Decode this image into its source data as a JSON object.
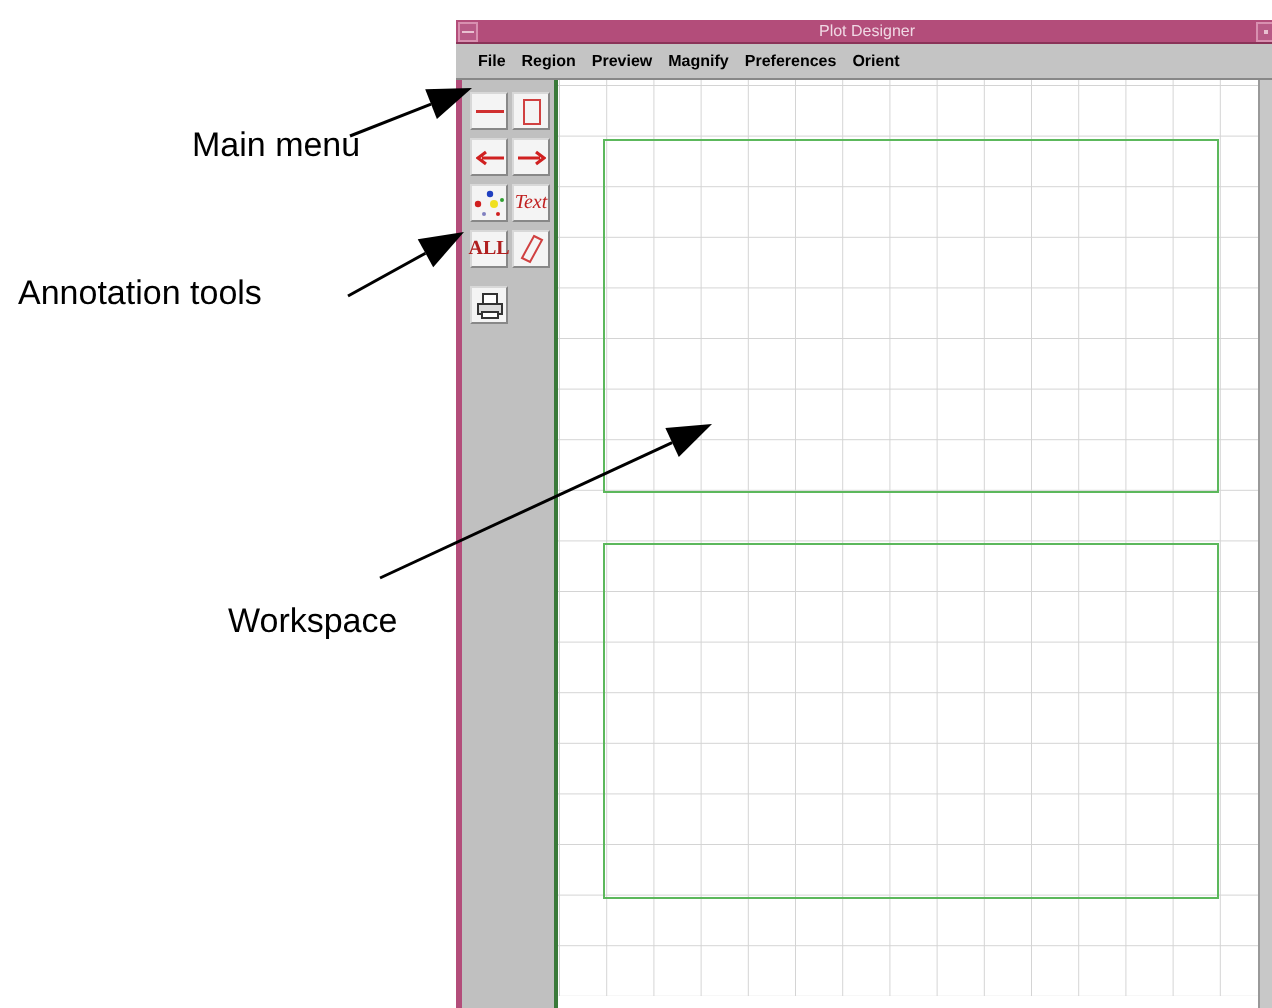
{
  "window": {
    "title": "Plot Designer"
  },
  "menu": [
    "File",
    "Region",
    "Preview",
    "Magnify",
    "Preferences",
    "Orient"
  ],
  "tools": [
    {
      "kind": "line"
    },
    {
      "kind": "rectangle"
    },
    {
      "kind": "left-arrow"
    },
    {
      "kind": "right-arrow"
    },
    {
      "kind": "symbols"
    },
    {
      "kind": "text",
      "label": "Text"
    },
    {
      "kind": "all",
      "label": "ALL"
    },
    {
      "kind": "eraser"
    },
    {
      "kind": "print"
    }
  ],
  "callouts": [
    {
      "label": "Main menu"
    },
    {
      "label": "Annotation tools"
    },
    {
      "label": "Workspace"
    }
  ]
}
